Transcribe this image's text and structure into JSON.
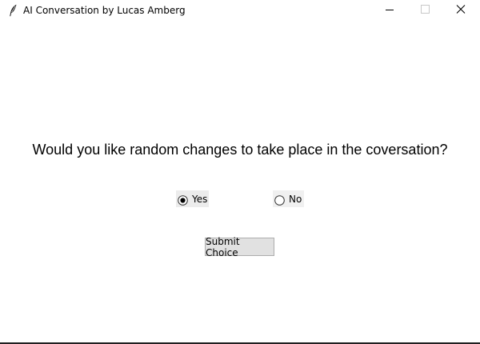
{
  "window": {
    "title": "AI Conversation by Lucas Amberg",
    "controls": {
      "minimize_icon": "minimize-icon",
      "maximize_icon": "maximize-icon",
      "close_icon": "close-icon"
    }
  },
  "main": {
    "question": "Would you like random changes to take place in the coversation?",
    "options": [
      {
        "label": "Yes",
        "selected": true
      },
      {
        "label": "No",
        "selected": false
      }
    ],
    "submit_label": "Submit Choice"
  },
  "colors": {
    "background": "#ffffff",
    "button_face": "#e1e1e1",
    "button_border": "#adadad",
    "radio_selected_dot": "#000000"
  }
}
